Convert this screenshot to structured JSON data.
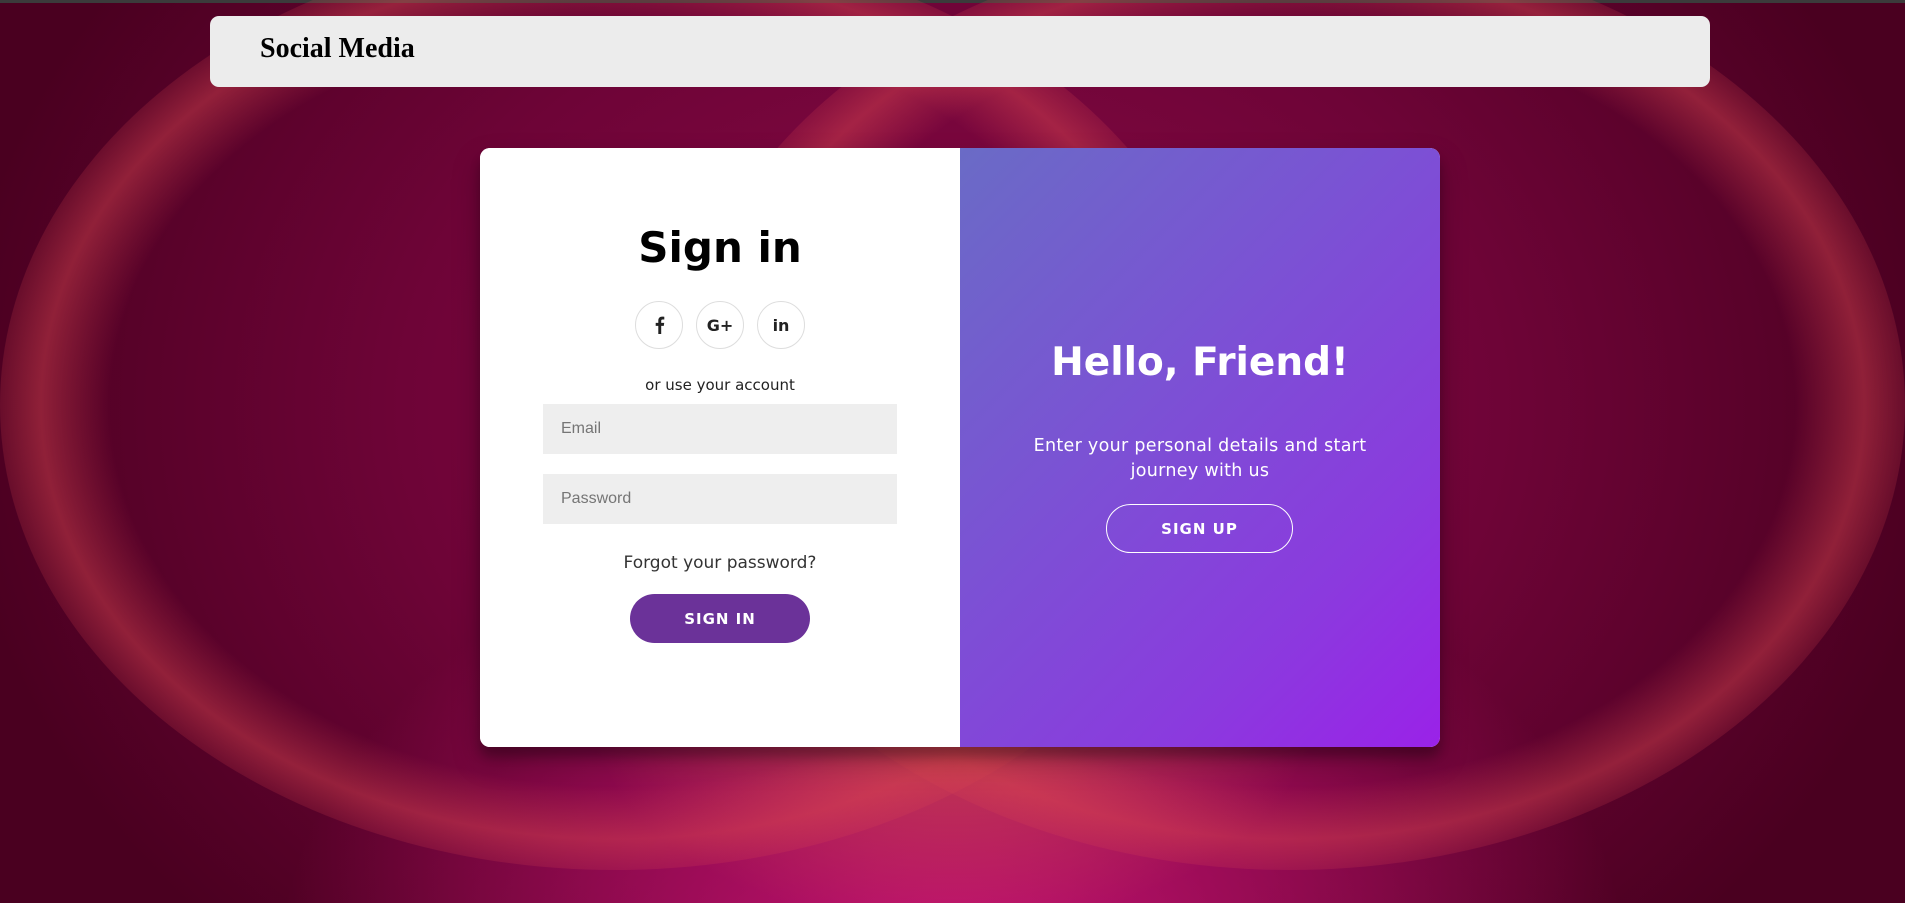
{
  "navbar": {
    "brand": "Social Media"
  },
  "signin": {
    "title": "Sign in",
    "social": [
      {
        "icon": "facebook-icon",
        "glyph": "f"
      },
      {
        "icon": "google-plus-icon",
        "glyph": "G+"
      },
      {
        "icon": "linkedin-icon",
        "glyph": "in"
      }
    ],
    "alt_text": "or use your account",
    "email_placeholder": "Email",
    "password_placeholder": "Password",
    "forgot": "Forgot your password?",
    "button": "SIGN IN"
  },
  "overlay": {
    "title": "Hello, Friend!",
    "subtitle": "Enter your personal details and start journey with us",
    "button": "SIGN UP"
  },
  "colors": {
    "signin_button": "#6b3299",
    "overlay_start": "#6a6bc6",
    "overlay_end": "#9a22e8",
    "background": "#8b0a47"
  }
}
